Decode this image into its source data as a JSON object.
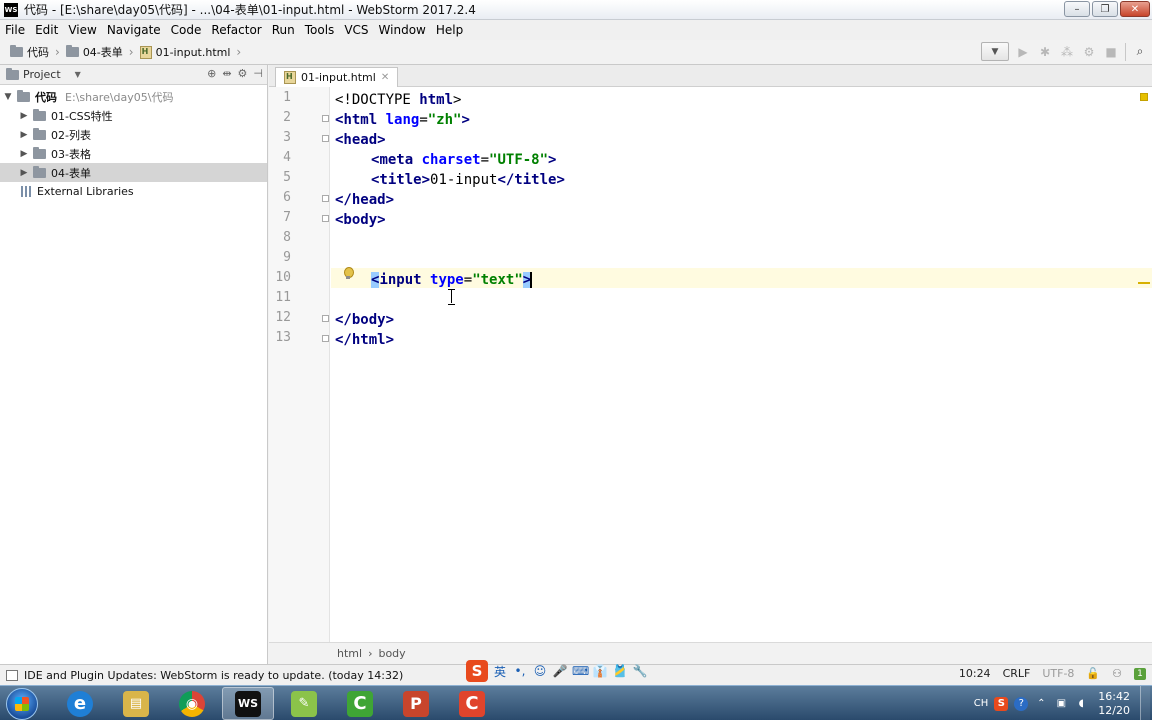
{
  "window": {
    "logo_text": "WS",
    "title": "代码 - [E:\\share\\day05\\代码] - ...\\04-表单\\01-input.html - WebStorm 2017.2.4",
    "controls": [
      "–",
      "❐",
      "✕"
    ]
  },
  "menu": [
    "File",
    "Edit",
    "View",
    "Navigate",
    "Code",
    "Refactor",
    "Run",
    "Tools",
    "VCS",
    "Window",
    "Help"
  ],
  "breadcrumb": [
    "代码",
    "04-表单",
    "01-input.html"
  ],
  "project_panel": {
    "title": "Project",
    "root": {
      "label": "代码",
      "path": "E:\\share\\day05\\代码"
    },
    "folders": [
      "01-CSS特性",
      "02-列表",
      "03-表格",
      "04-表单"
    ],
    "external": "External Libraries"
  },
  "editor": {
    "tab": "01-input.html",
    "line_numbers": [
      "1",
      "2",
      "3",
      "4",
      "5",
      "6",
      "7",
      "8",
      "9",
      "10",
      "11",
      "12",
      "13"
    ],
    "lines": {
      "l1": {
        "open": "<!DOCTYPE ",
        "tag": "html",
        "close": ">"
      },
      "l2": {
        "open": "<",
        "tag": "html",
        "attr": " lang",
        "eq": "=",
        "val": "\"zh\"",
        "close": ">"
      },
      "l3": {
        "text": "<head>"
      },
      "l4": {
        "open": "<",
        "tag": "meta",
        "attr": " charset",
        "eq": "=",
        "val": "\"UTF-8\"",
        "close": ">"
      },
      "l5": {
        "t1": "<title>",
        "content": "01-input",
        "t2": "</title>"
      },
      "l6": {
        "text": "</head>"
      },
      "l7": {
        "text": "<body>"
      },
      "l10": {
        "lt": "<",
        "tag": "input",
        "attr": " type",
        "eq": "=",
        "val": "\"text\"",
        "gt": ">"
      },
      "l12": {
        "text": "</body>"
      },
      "l13": {
        "text": "</html>"
      }
    },
    "bottom_crumbs": [
      "html",
      "body"
    ]
  },
  "status": {
    "message": "IDE and Plugin Updates: WebStorm is ready to update. (today 14:32)",
    "position": "10:24",
    "line_sep": "CRLF",
    "encoding": "UTF-8",
    "badge": "1"
  },
  "ime": {
    "logo": "S",
    "mode": "英",
    "items": [
      "•,",
      "☺",
      "🎤",
      "⌨",
      "👔",
      "🎽",
      "🔧"
    ]
  },
  "taskbar": {
    "apps": [
      {
        "name": "internet-explorer",
        "glyph": "e",
        "color": "#1f7fd6"
      },
      {
        "name": "file-explorer",
        "glyph": "▤",
        "color": "#d9b54a"
      },
      {
        "name": "chrome",
        "glyph": "◉",
        "color": "#d94436"
      },
      {
        "name": "webstorm",
        "glyph": "WS",
        "color": "#111111"
      },
      {
        "name": "notepad-plus",
        "glyph": "✎",
        "color": "#8bc34a"
      },
      {
        "name": "camtasia-green",
        "glyph": "C",
        "color": "#3fa535"
      },
      {
        "name": "powerpoint",
        "glyph": "P",
        "color": "#c8452c"
      },
      {
        "name": "camtasia-red",
        "glyph": "C",
        "color": "#e0442c"
      }
    ],
    "tray": {
      "lang": "CH",
      "time": "16:42",
      "date": "12/20"
    }
  }
}
